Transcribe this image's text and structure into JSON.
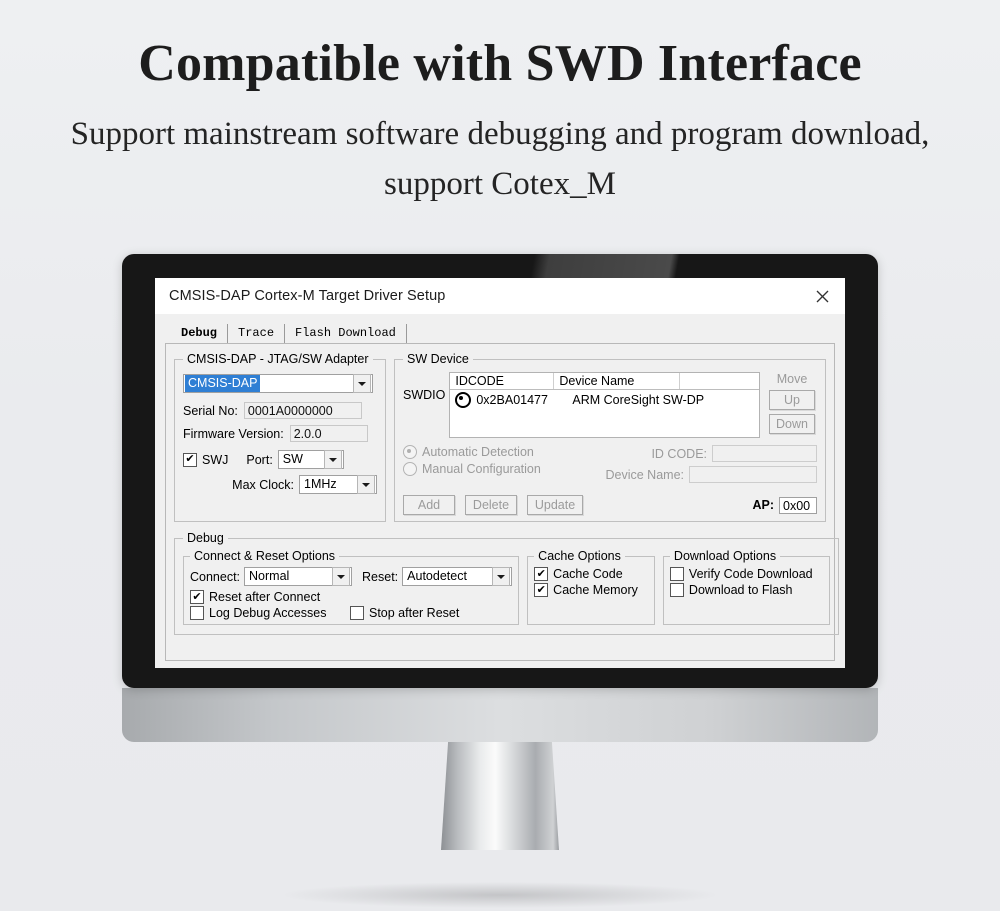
{
  "banner": {
    "headline": "Compatible with SWD Interface",
    "subline": "Support mainstream software debugging and program download, support Cotex_M"
  },
  "dialog": {
    "title": "CMSIS-DAP Cortex-M Target Driver Setup",
    "close_icon": "close-icon",
    "tabs": [
      {
        "label": "Debug",
        "active": true
      },
      {
        "label": "Trace",
        "active": false
      },
      {
        "label": "Flash Download",
        "active": false
      }
    ],
    "adapter_group": {
      "legend": "CMSIS-DAP - JTAG/SW Adapter",
      "adapter_selected": "CMSIS-DAP",
      "serial_label": "Serial No:",
      "serial_value": "0001A0000000",
      "firmware_label": "Firmware Version:",
      "firmware_value": "2.0.0",
      "swj_label": "SWJ",
      "swj_checked": "✔",
      "port_label": "Port:",
      "port_value": "SW",
      "max_clock_label": "Max Clock:",
      "max_clock_value": "1MHz"
    },
    "sw_device_group": {
      "legend": "SW Device",
      "bus_label": "SWDIO",
      "columns": [
        "IDCODE",
        "Device Name",
        ""
      ],
      "rows": [
        {
          "idcode": "0x2BA01477",
          "device_name": "ARM CoreSight SW-DP"
        }
      ],
      "move_label": "Move",
      "up_label": "Up",
      "down_label": "Down",
      "automatic_detection_label": "Automatic Detection",
      "manual_configuration_label": "Manual Configuration",
      "id_code_label": "ID CODE:",
      "id_code_value": "",
      "device_name_label": "Device Name:",
      "device_name_value": "",
      "add_label": "Add",
      "delete_label": "Delete",
      "update_label": "Update",
      "ap_label": "AP:",
      "ap_value": "0x00"
    },
    "debug_group": {
      "legend": "Debug",
      "connect_reset": {
        "legend": "Connect & Reset Options",
        "connect_label": "Connect:",
        "connect_value": "Normal",
        "reset_label": "Reset:",
        "reset_value": "Autodetect",
        "reset_after_connect_label": "Reset after Connect",
        "reset_after_connect_checked": "✔",
        "log_debug_accesses_label": "Log Debug Accesses",
        "stop_after_reset_label": "Stop after Reset"
      },
      "cache_options": {
        "legend": "Cache Options",
        "cache_code_label": "Cache Code",
        "cache_code_checked": "✔",
        "cache_memory_label": "Cache Memory",
        "cache_memory_checked": "✔"
      },
      "download_options": {
        "legend": "Download Options",
        "verify_code_download_label": "Verify Code Download",
        "download_to_flash_label": "Download to Flash"
      }
    }
  }
}
